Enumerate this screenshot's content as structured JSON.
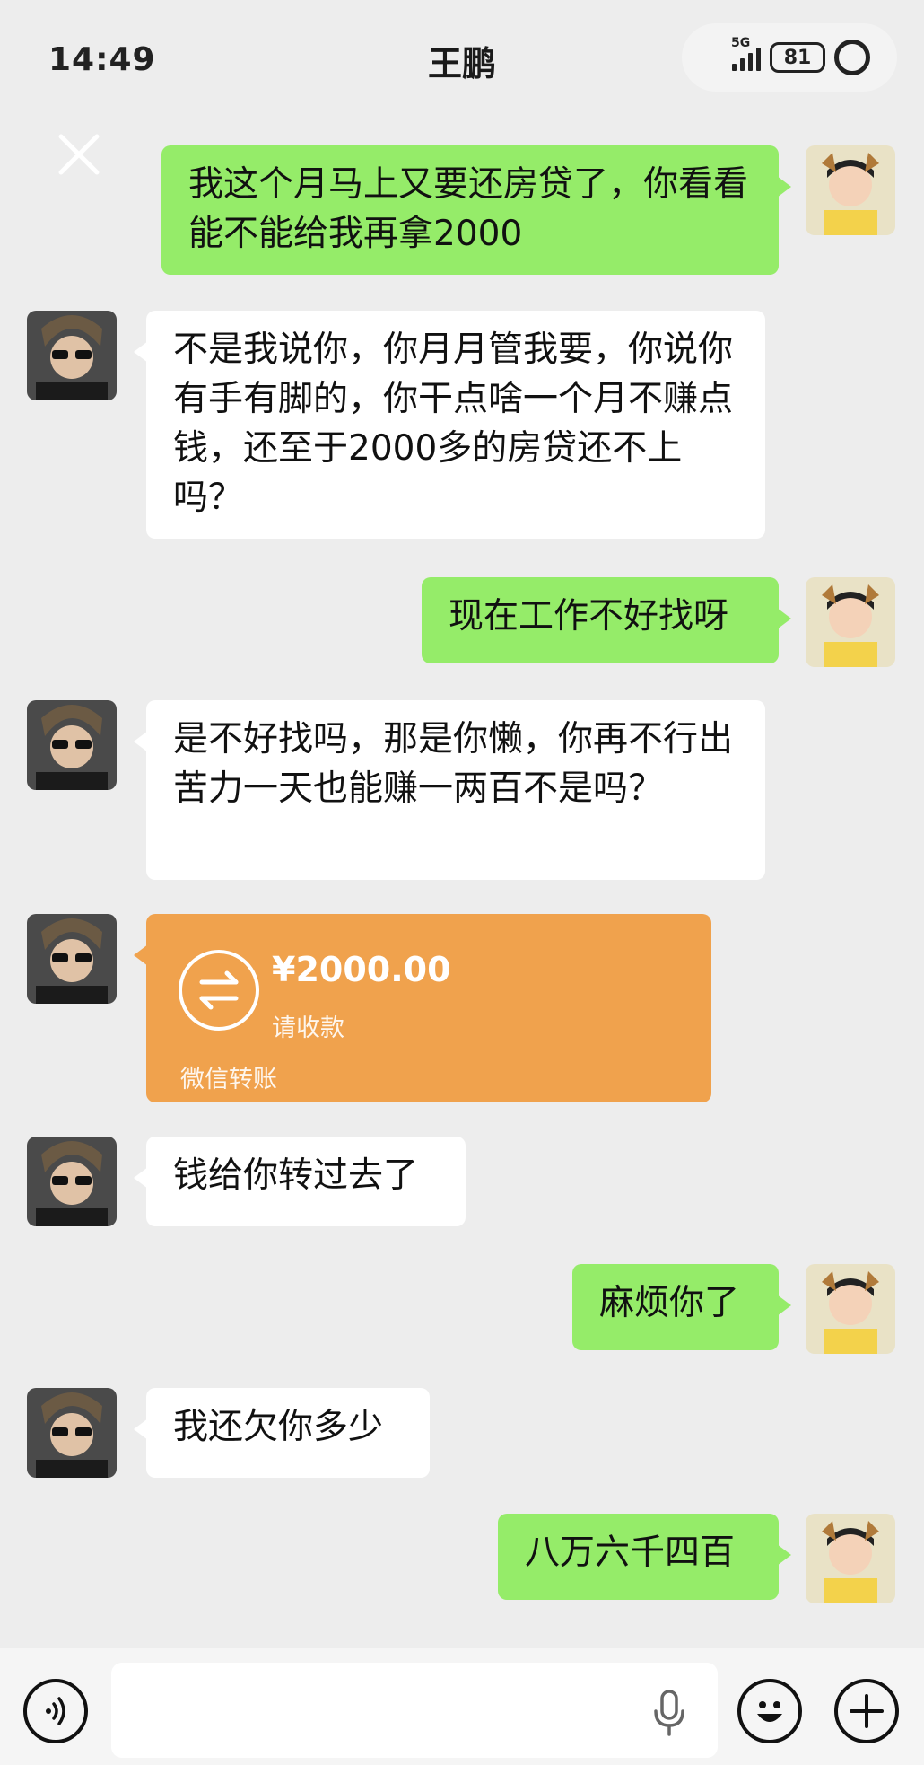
{
  "header": {
    "time": "14:49",
    "title": "王鹏",
    "network": "5G",
    "battery": "81"
  },
  "messages": [
    {
      "sender": "me",
      "text": "我这个月马上又要还房贷了，你看看能不能给我再拿2000"
    },
    {
      "sender": "other",
      "text": "不是我说你，你月月管我要，你说你有手有脚的，你干点啥一个月不赚点钱，还至于2000多的房贷还不上吗？"
    },
    {
      "sender": "me",
      "text": "现在工作不好找呀"
    },
    {
      "sender": "other",
      "text": "是不好找吗，那是你懒，你再不行出苦力一天也能赚一两百不是吗？"
    },
    {
      "sender": "other",
      "type": "transfer",
      "amount": "¥2000.00",
      "status": "请收款",
      "footer": "微信转账"
    },
    {
      "sender": "other",
      "text": "钱给你转过去了"
    },
    {
      "sender": "me",
      "text": "麻烦你了"
    },
    {
      "sender": "other",
      "text": "我还欠你多少"
    },
    {
      "sender": "me",
      "text": "八万六千四百"
    }
  ],
  "input": {
    "placeholder": ""
  },
  "colors": {
    "background": "#ededed",
    "me_bubble": "#95ec69",
    "other_bubble": "#ffffff",
    "transfer": "#f0a24d"
  },
  "icons": [
    "back-chevron-icon",
    "signal-icon",
    "battery-icon",
    "more-icon",
    "close-icon",
    "transfer-arrows-icon",
    "voice-icon",
    "mic-icon",
    "emoji-icon",
    "plus-icon"
  ]
}
